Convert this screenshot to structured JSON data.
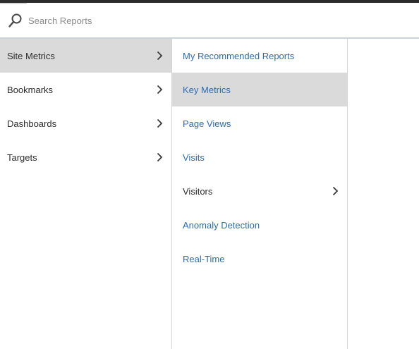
{
  "search": {
    "placeholder": "Search Reports",
    "icon": "search-icon"
  },
  "categories": [
    {
      "label": "Site Metrics",
      "selected": true,
      "has_submenu": true
    },
    {
      "label": "Bookmarks",
      "selected": false,
      "has_submenu": true
    },
    {
      "label": "Dashboards",
      "selected": false,
      "has_submenu": true
    },
    {
      "label": "Targets",
      "selected": false,
      "has_submenu": true
    }
  ],
  "reports": [
    {
      "label": "My Recommended Reports",
      "kind": "link",
      "selected": false,
      "has_submenu": false
    },
    {
      "label": "Key Metrics",
      "kind": "link",
      "selected": true,
      "has_submenu": false
    },
    {
      "label": "Page Views",
      "kind": "link",
      "selected": false,
      "has_submenu": false
    },
    {
      "label": "Visits",
      "kind": "link",
      "selected": false,
      "has_submenu": false
    },
    {
      "label": "Visitors",
      "kind": "plain",
      "selected": false,
      "has_submenu": true
    },
    {
      "label": "Anomaly Detection",
      "kind": "link",
      "selected": false,
      "has_submenu": false
    },
    {
      "label": "Real-Time",
      "kind": "link",
      "selected": false,
      "has_submenu": false
    }
  ],
  "colors": {
    "link": "#2d6cb3",
    "text": "#2c2c2c",
    "selected_bg": "#dadada",
    "top_bar": "#2c2c2c"
  }
}
